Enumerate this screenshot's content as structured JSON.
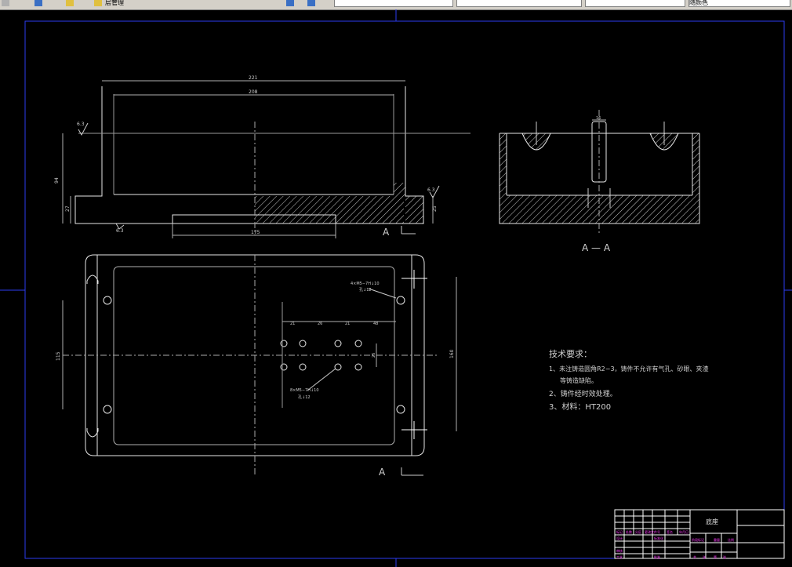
{
  "toolbar": {
    "left_label": "层管理",
    "combo_layer": "",
    "combo_color": "",
    "combo_linetype": "",
    "combo_lineweight": "",
    "combo_plotstyle": "随颜色"
  },
  "drawing": {
    "dims": {
      "top_outer": "221",
      "top_inner": "208",
      "height_total": "94",
      "height_base": "27",
      "base_right": "25",
      "bottom_slot": "175",
      "plan_height_left": "115",
      "plan_height_right": "160",
      "grid_a": "21",
      "grid_b": "26",
      "grid_c": "21",
      "grid_d": "48",
      "grid_vert": "25",
      "section_width": "16"
    },
    "roughness": {
      "r1": "6.3",
      "r2": "6.3",
      "r3": "6.3"
    },
    "callouts": {
      "top_right_line1": "4×M5−7H↓10",
      "top_right_line2": "孔↓12",
      "center_line1": "8×M5−7H↓10",
      "center_line2": "孔↓12"
    },
    "section_marks": {
      "mark_top": "A",
      "mark_bottom": "A",
      "section_title": "A — A"
    },
    "tech_requirements": {
      "heading": "技术要求：",
      "item1": "1、未注铸造圆角R2−3，铸件不允许有气孔、砂眼、夹渣",
      "item1b": "等铸造缺陷。",
      "item2": "2、铸件经时效处理。",
      "item3": "3、材料：HT200"
    },
    "title_block": {
      "part_name": "底座",
      "cells": [
        "标记",
        "处数",
        "分区",
        "更改文件号",
        "签名",
        "年月日",
        "设计",
        "标准化",
        "阶段标记",
        "重量",
        "比例",
        "审核",
        "工艺",
        "批准",
        "共",
        "张",
        "第",
        "张"
      ]
    }
  }
}
